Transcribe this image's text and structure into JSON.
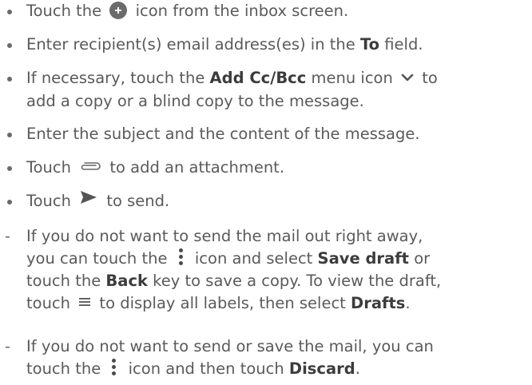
{
  "bullets": [
    {
      "before": "Touch the ",
      "icon": "compose-plus-icon",
      "after": " icon from the inbox screen."
    },
    {
      "before": "Enter recipient(s) email address(es) in the ",
      "bold": "To",
      "after": " field."
    },
    {
      "line1_before": "If necessary, touch the ",
      "bold": "Add Cc/Bcc",
      "line1_after": " menu icon ",
      "icon": "chevron-down-icon",
      "line1_end": " to",
      "line2": "add a copy or a blind copy to the message."
    },
    {
      "text": "Enter the subject and the content of the message."
    },
    {
      "before": "Touch ",
      "icon": "paperclip-icon",
      "after": " to add an attachment."
    },
    {
      "before": "Touch ",
      "icon": "send-icon",
      "after": " to send."
    }
  ],
  "notes": [
    {
      "dash": "-",
      "l1": "If you do not want to send the mail out right away,",
      "l2_before": "you can touch the ",
      "l2_icon": "more-vert-icon",
      "l2_mid": " icon and select ",
      "l2_bold": "Save draft",
      "l2_after": " or",
      "l3_before": "touch the ",
      "l3_bold": "Back",
      "l3_after": " key to save a copy. To view the draft,",
      "l4_before": "touch ",
      "l4_icon": "menu-icon",
      "l4_mid": " to display all labels, then select ",
      "l4_bold": "Drafts",
      "l4_after": "."
    },
    {
      "dash": "-",
      "l1": "If you do not want to send or save the mail, you can",
      "l2_before": "touch the ",
      "l2_icon": "more-vert-icon",
      "l2_mid": " icon and then touch ",
      "l2_bold": "Discard",
      "l2_after": "."
    }
  ]
}
